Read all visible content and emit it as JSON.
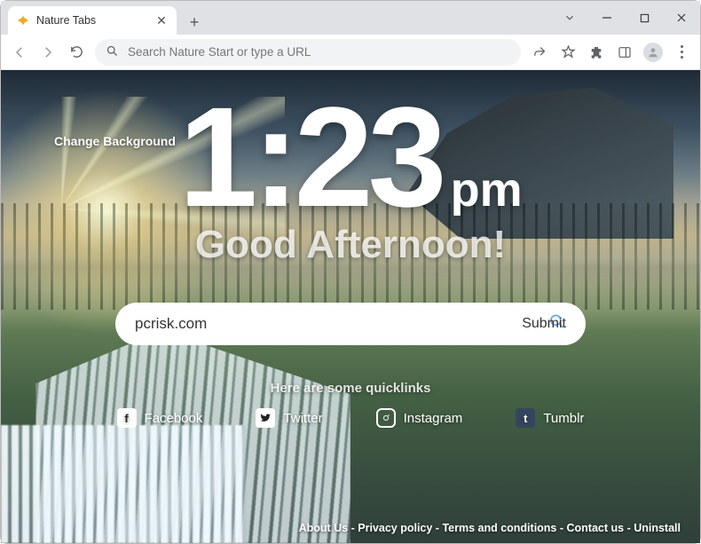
{
  "browser": {
    "tab_title": "Nature Tabs",
    "omnibox_placeholder": "Search Nature Start or type a URL"
  },
  "page": {
    "change_background_label": "Change Background",
    "clock": {
      "time": "1:23",
      "ampm": "pm"
    },
    "greeting": "Good Afternoon!",
    "search": {
      "value": "pcrisk.com",
      "submit_label": "Submit"
    },
    "quicklinks_heading": "Here are some quicklinks",
    "quicklinks": [
      {
        "label": "Facebook",
        "glyph": "f"
      },
      {
        "label": "Twitter",
        "glyph": "t"
      },
      {
        "label": "Instagram",
        "glyph": "◎"
      },
      {
        "label": "Tumblr",
        "glyph": "t"
      }
    ],
    "footer": {
      "items": [
        "About Us",
        "Privacy policy",
        "Terms and conditions",
        "Contact us",
        "Uninstall"
      ],
      "sep": " - "
    }
  }
}
